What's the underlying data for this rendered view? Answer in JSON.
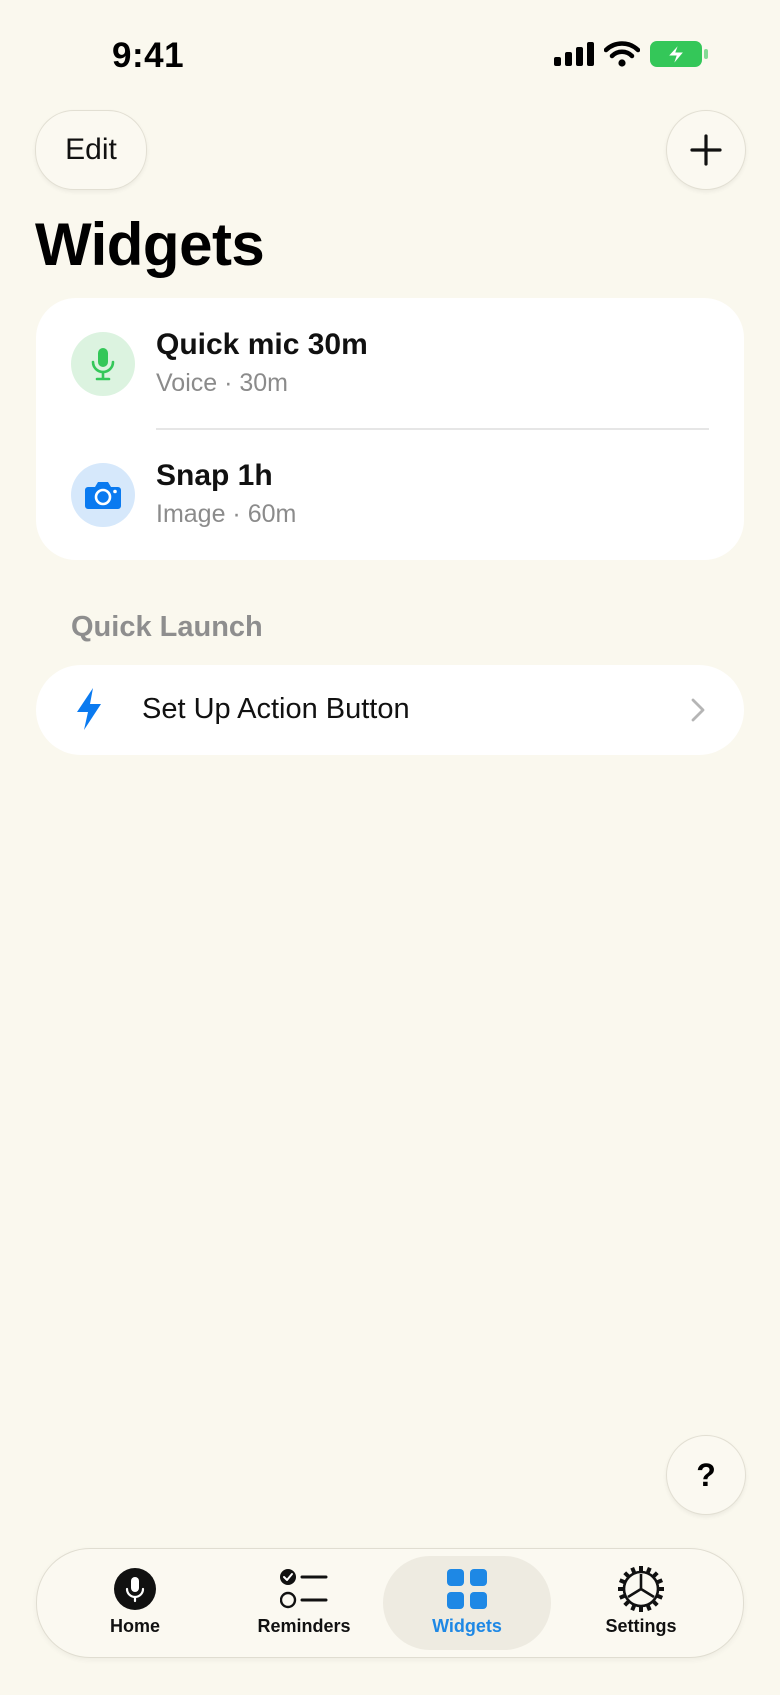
{
  "status_bar": {
    "time": "9:41"
  },
  "header": {
    "edit_label": "Edit",
    "title": "Widgets",
    "add_icon": "plus-icon"
  },
  "widgets": [
    {
      "title": "Quick mic 30m",
      "subtitle": "Voice · 30m",
      "icon": "mic-icon",
      "icon_color": "#34C759",
      "icon_bg": "#DCF3E0"
    },
    {
      "title": "Snap 1h",
      "subtitle": "Image · 60m",
      "icon": "camera-icon",
      "icon_color": "#0A7AF0",
      "icon_bg": "#D6E8FB"
    }
  ],
  "quick_launch": {
    "section_label": "Quick Launch",
    "action_label": "Set Up Action Button",
    "icon": "bolt-icon",
    "icon_color": "#0A7AF0"
  },
  "help_label": "?",
  "tabbar": {
    "active": "Widgets",
    "accent": "#1E88E5",
    "tabs": [
      {
        "label": "Home",
        "icon": "mic-icon"
      },
      {
        "label": "Reminders",
        "icon": "checklist-icon"
      },
      {
        "label": "Widgets",
        "icon": "widgets-grid-icon"
      },
      {
        "label": "Settings",
        "icon": "gear-icon"
      }
    ]
  }
}
